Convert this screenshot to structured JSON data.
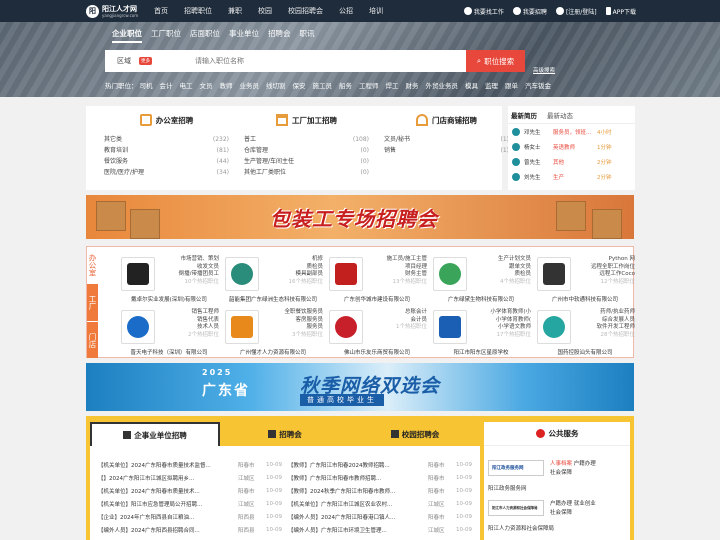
{
  "topbar": {
    "logo_name": "阳江人才网",
    "logo_sub": "yangjiangrcw.com",
    "nav": [
      "首页",
      "招聘职位",
      "兼职",
      "校园",
      "校园招聘会",
      "公招",
      "培训"
    ],
    "links": [
      "我要找工作",
      "我要招聘",
      "[注册/登陆]",
      "APP下载"
    ]
  },
  "search": {
    "tabs": [
      "企业职位",
      "工厂职位",
      "店面职位",
      "事业单位",
      "招聘会",
      "职讯"
    ],
    "area_label": "区域",
    "more_badge": "更多",
    "placeholder": "请输入职位名称",
    "button": "职位搜索",
    "advanced": "高级搜索",
    "hot_label": "热门职位：",
    "hot": [
      "司机",
      "会计",
      "电工",
      "文员",
      "教师",
      "业务员",
      "线切割",
      "保安",
      "施工员",
      "船务",
      "工程师",
      "焊工",
      "财务",
      "外贸业务员",
      "模具",
      "监理",
      "跟单",
      "汽车钣金"
    ]
  },
  "categories": [
    {
      "title": "办公室招聘",
      "rows": [
        [
          "其它类",
          "(232)"
        ],
        [
          "教育培训",
          "(81)"
        ],
        [
          "餐饮服务",
          "(44)"
        ],
        [
          "医院/医疗/护理",
          "(34)"
        ]
      ]
    },
    {
      "title": "工厂加工招聘",
      "rows": [
        [
          "普工",
          "(108)"
        ],
        [
          "仓库管理",
          "(0)"
        ],
        [
          "生产管理/车间主任",
          "(0)"
        ],
        [
          "其他工厂类职位",
          "(0)"
        ]
      ]
    },
    {
      "title": "门店商铺招聘",
      "rows": [
        [
          "文员/秘书",
          "(1)"
        ],
        [
          "销售",
          "(1)"
        ]
      ]
    }
  ],
  "resumes": {
    "tabs": [
      "最新简历",
      "最新动态"
    ],
    "items": [
      {
        "name": "邓先生",
        "job": "服务员，领班...",
        "time": "4小时"
      },
      {
        "name": "杨女士",
        "job": "英语教师",
        "time": "1分钟"
      },
      {
        "name": "曾先生",
        "job": "其他",
        "time": "2分钟"
      },
      {
        "name": "刘先生",
        "job": "生产",
        "time": "2分钟"
      }
    ]
  },
  "banner1": {
    "text": "包装工专场招聘会"
  },
  "enterprise": {
    "side_tabs": [
      "办公室",
      "工厂",
      "门店"
    ],
    "cards": [
      {
        "jobs": [
          "市场营销、策划",
          "收发文员",
          "倒播/带播团员工"
        ],
        "more": "10个热招职位",
        "company": "戴卓尔实业发展(深圳)有限公司",
        "logo": "gold",
        "color": "#222"
      },
      {
        "jobs": [
          "机修",
          "质检员",
          "模具副部员"
        ],
        "more": "16个热招职位",
        "company": "韶能集团广东绿洲生态科技有限公司",
        "logo": "leaf",
        "color": "#2a8c7a"
      },
      {
        "jobs": [
          "施工员/施工主管",
          "项目经理",
          "财务主管"
        ],
        "more": "13个热招职位",
        "company": "广东创华城市建设有限公司",
        "logo": "build",
        "color": "#c21f1f"
      },
      {
        "jobs": [
          "生产计划文员",
          "跟单文员",
          "质检员"
        ],
        "more": "4个热招职位",
        "company": "广东绿黛生物科技有限公司",
        "logo": "green",
        "color": "#3aa55a"
      },
      {
        "jobs": [
          "Python 网",
          "远程全职工作岗位",
          "远程工作Coco"
        ],
        "more": "12个热招职位",
        "company": "广州市中软通科技有限公司",
        "logo": "box",
        "color": "#333"
      },
      {
        "jobs": [
          "销售工程师",
          "销售代表",
          "技术人员"
        ],
        "more": "2个热招职位",
        "company": "晋天电子科技（深圳）有限公司",
        "logo": "swirl",
        "color": "#1a6cc8"
      },
      {
        "jobs": [
          "全职餐饮服务员",
          "客房服务员",
          "服务员"
        ],
        "more": "3个热招职位",
        "company": "广州懂才人力资源有限公司",
        "logo": "xiqu",
        "color": "#e88a1b"
      },
      {
        "jobs": [
          "总账会计",
          "会计员"
        ],
        "more": "1个热招职位",
        "company": "佛山市乐友乐商贸有限公司",
        "logo": "red",
        "color": "#c8202a"
      },
      {
        "jobs": [
          "小学体育教师(小",
          "小学体育教师(",
          "小学语文教师"
        ],
        "more": "17个热招职位",
        "company": "阳江市阳东区星原学校",
        "logo": "school",
        "color": "#1a5fb4"
      },
      {
        "jobs": [
          "药师/执业药师",
          "综合发展人员",
          "软件开发工程师"
        ],
        "more": "28个热招职位",
        "company": "国药控股汕头有限公司",
        "logo": "teal",
        "color": "#26a6a0"
      }
    ]
  },
  "banner2": {
    "year": "2025",
    "province": "广东省",
    "title": "秋季网络双选会",
    "sub": "普通高校毕业生"
  },
  "news": {
    "tabs": [
      "企事业单位招聘",
      "招聘会",
      "校园招聘会"
    ],
    "left": [
      {
        "title": "【机关单位】2024广东阳春市质量技术监督...",
        "city": "阳春市",
        "date": "10-09"
      },
      {
        "title": "【】2024广东阳江市江城区拟聘用乡...",
        "city": "江城区",
        "date": "10-09"
      },
      {
        "title": "【机关单位】2024广东阳春市质量技术...",
        "city": "阳春市",
        "date": "10-09"
      },
      {
        "title": "【机关单位】阳江市应急管理局公开招聘...",
        "city": "江城区",
        "date": "10-09"
      },
      {
        "title": "【企业】2024年广东阳西县自江粮油...",
        "city": "阳西县",
        "date": "10-09"
      },
      {
        "title": "【编外人员】2024广东阳西县招聘合同...",
        "city": "阳西县",
        "date": "10-09"
      }
    ],
    "right": [
      {
        "title": "【教师】广东阳江市阳春2024教师招聘...",
        "city": "阳春市",
        "date": "10-09"
      },
      {
        "title": "【教师】广东阳江市阳春市教师招聘...",
        "city": "阳春市",
        "date": "10-09"
      },
      {
        "title": "【教师】2024秋季广东阳江市阳春市教师...",
        "city": "阳春市",
        "date": "10-09"
      },
      {
        "title": "【机关单位】广东阳江市江城区农业农村...",
        "city": "江城区",
        "date": "10-09"
      },
      {
        "title": "【编外人员】2024广东阳江阳春港口镇人...",
        "city": "阳春市",
        "date": "10-09"
      },
      {
        "title": "【编外人员】广东阳江市环境卫生管理...",
        "city": "江城区",
        "date": "10-09"
      }
    ]
  },
  "services": {
    "title": "公共服务",
    "items": [
      {
        "box": "阳江政务服务网",
        "links": [
          "人事档案",
          "户籍办理",
          "社会保障"
        ],
        "name": "阳江政务服务网"
      },
      {
        "box": "阳江市人力资源和社会保障局",
        "links": [
          "户籍办理",
          "就业创业",
          "社会保障"
        ],
        "name": "阳江人力资源和社会保障局"
      }
    ]
  }
}
